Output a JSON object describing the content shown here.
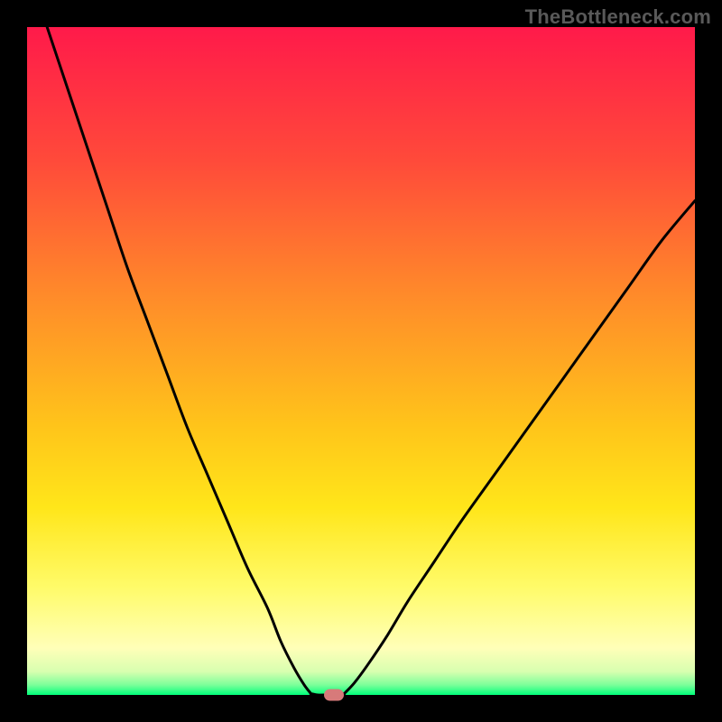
{
  "watermark": "TheBottleneck.com",
  "chart_data": {
    "type": "line",
    "title": "",
    "xlabel": "",
    "ylabel": "",
    "xlim": [
      0,
      100
    ],
    "ylim": [
      0,
      100
    ],
    "grid": false,
    "legend": false,
    "background_gradient": {
      "stops": [
        {
          "pos": 0.0,
          "color": "#ff1a4a"
        },
        {
          "pos": 0.2,
          "color": "#ff4a3a"
        },
        {
          "pos": 0.4,
          "color": "#ff8a2a"
        },
        {
          "pos": 0.6,
          "color": "#ffc51a"
        },
        {
          "pos": 0.72,
          "color": "#ffe61a"
        },
        {
          "pos": 0.84,
          "color": "#fffb6a"
        },
        {
          "pos": 0.93,
          "color": "#ffffb8"
        },
        {
          "pos": 0.965,
          "color": "#d8ffb0"
        },
        {
          "pos": 0.985,
          "color": "#7cff9a"
        },
        {
          "pos": 1.0,
          "color": "#00ff7a"
        }
      ]
    },
    "series": [
      {
        "name": "bottleneck-curve-left",
        "x": [
          3,
          6,
          9,
          12,
          15,
          18,
          21,
          24,
          27,
          30,
          33,
          36,
          38,
          40,
          41.5,
          42.5
        ],
        "y": [
          100,
          91,
          82,
          73,
          64,
          56,
          48,
          40,
          33,
          26,
          19,
          13,
          8,
          4,
          1.5,
          0.2
        ]
      },
      {
        "name": "bottleneck-curve-floor",
        "x": [
          42.5,
          43.5,
          45,
          46.5,
          47.5
        ],
        "y": [
          0.2,
          0.0,
          0.0,
          0.0,
          0.2
        ]
      },
      {
        "name": "bottleneck-curve-right",
        "x": [
          47.5,
          49,
          51,
          54,
          57,
          61,
          65,
          70,
          75,
          80,
          85,
          90,
          95,
          100
        ],
        "y": [
          0.2,
          1.8,
          4.5,
          9,
          14,
          20,
          26,
          33,
          40,
          47,
          54,
          61,
          68,
          74
        ]
      }
    ],
    "marker": {
      "name": "optimal-point",
      "x": 46,
      "y": 0,
      "color": "#d77a7a"
    },
    "annotations": []
  }
}
